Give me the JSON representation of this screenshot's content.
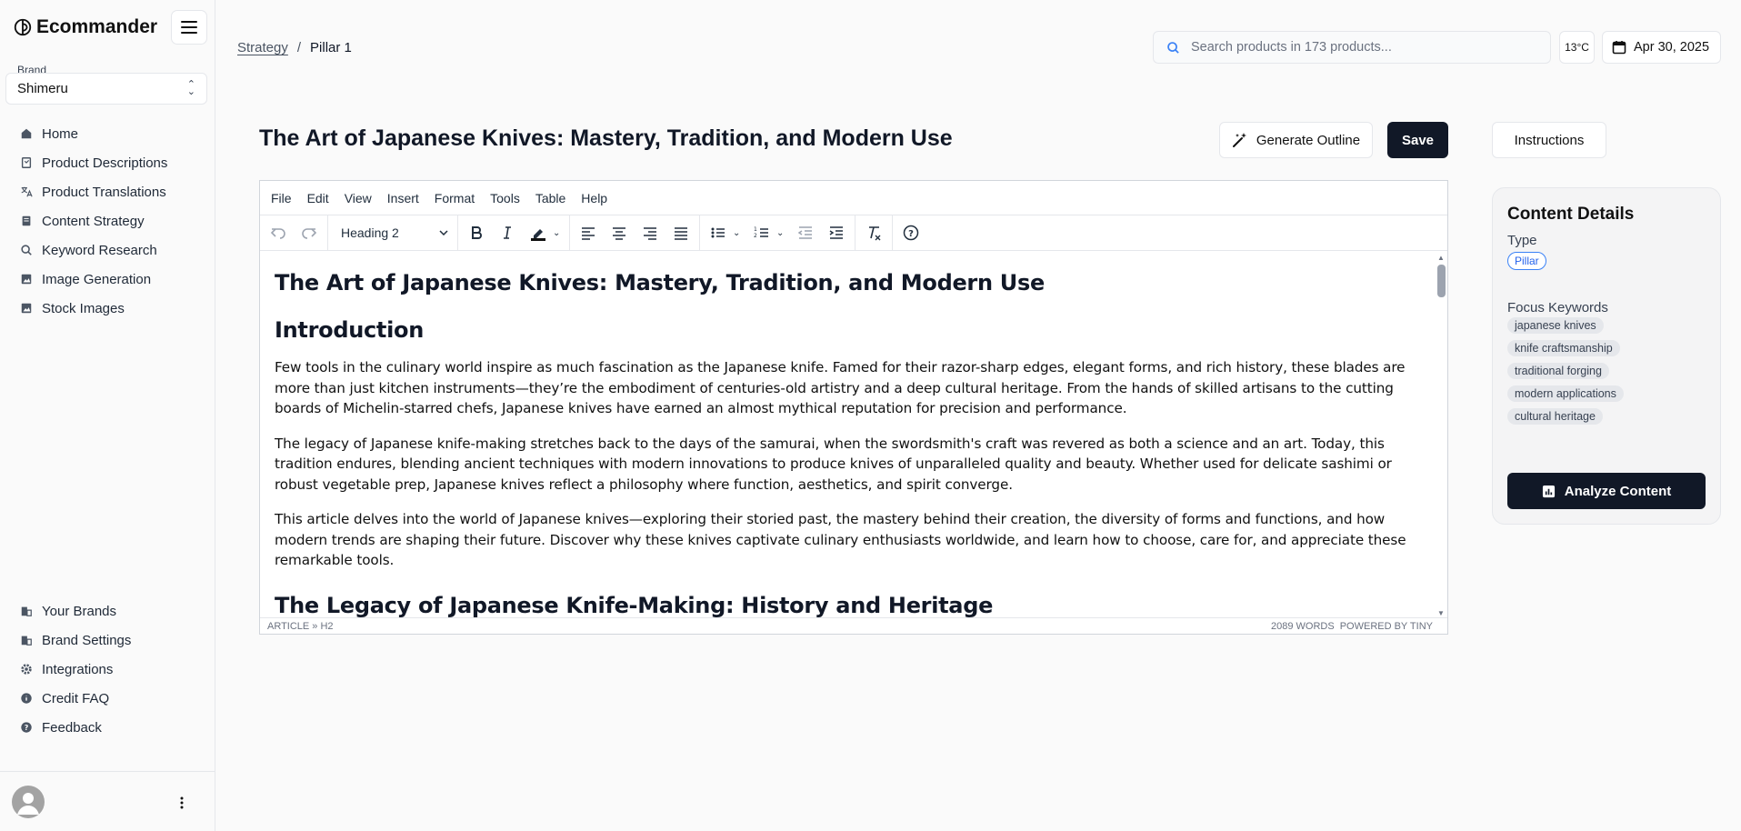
{
  "app": {
    "name": "Ecommander"
  },
  "brand": {
    "label": "Brand",
    "value": "Shimeru"
  },
  "nav_top": [
    {
      "label": "Home",
      "icon": "home-icon"
    },
    {
      "label": "Product Descriptions",
      "icon": "clipboard-icon"
    },
    {
      "label": "Product Translations",
      "icon": "translate-icon"
    },
    {
      "label": "Content Strategy",
      "icon": "book-icon"
    },
    {
      "label": "Keyword Research",
      "icon": "search-icon"
    },
    {
      "label": "Image Generation",
      "icon": "image-icon"
    },
    {
      "label": "Stock Images",
      "icon": "image-icon"
    }
  ],
  "nav_bottom": [
    {
      "label": "Your Brands",
      "icon": "building-icon"
    },
    {
      "label": "Brand Settings",
      "icon": "building-icon"
    },
    {
      "label": "Integrations",
      "icon": "gear-icon"
    },
    {
      "label": "Credit FAQ",
      "icon": "info-icon"
    },
    {
      "label": "Feedback",
      "icon": "help-icon"
    }
  ],
  "breadcrumb": {
    "parent": "Strategy",
    "separator": "/",
    "current": "Pillar 1"
  },
  "search": {
    "placeholder": "Search products in 173 products..."
  },
  "weather": {
    "temp": "13°C"
  },
  "date": {
    "value": "Apr 30, 2025"
  },
  "document": {
    "title": "The Art of Japanese Knives: Mastery, Tradition, and Modern Use"
  },
  "actions": {
    "generate_outline": "Generate Outline",
    "save": "Save",
    "instructions": "Instructions"
  },
  "editor": {
    "menus": [
      "File",
      "Edit",
      "View",
      "Insert",
      "Format",
      "Tools",
      "Table",
      "Help"
    ],
    "block_format": "Heading 2",
    "content": {
      "h1": "The Art of Japanese Knives: Mastery, Tradition, and Modern Use",
      "h2_intro": "Introduction",
      "p1": "Few tools in the culinary world inspire as much fascination as the Japanese knife. Famed for their razor-sharp edges, elegant forms, and rich history, these blades are more than just kitchen instruments—they’re the embodiment of centuries-old artistry and a deep cultural heritage. From the hands of skilled artisans to the cutting boards of Michelin-starred chefs, Japanese knives have earned an almost mythical reputation for precision and performance.",
      "p2": "The legacy of Japanese knife-making stretches back to the days of the samurai, when the swordsmith's craft was revered as both a science and an art. Today, this tradition endures, blending ancient techniques with modern innovations to produce knives of unparalleled quality and beauty. Whether used for delicate sashimi or robust vegetable prep, Japanese knives reflect a philosophy where function, aesthetics, and spirit converge.",
      "p3": "This article delves into the world of Japanese knives—exploring their storied past, the mastery behind their creation, the diversity of forms and functions, and how modern trends are shaping their future. Discover why these knives captivate culinary enthusiasts worldwide, and learn how to choose, care for, and appreciate these remarkable tools.",
      "h2_legacy": "The Legacy of Japanese Knife-Making: History and Heritage"
    },
    "status_path": "ARTICLE » H2",
    "word_count": "2089 WORDS",
    "powered_by": "POWERED BY TINY"
  },
  "details": {
    "title": "Content Details",
    "type_label": "Type",
    "type_value": "Pillar",
    "keywords_label": "Focus Keywords",
    "keywords": [
      "japanese knives",
      "knife craftsmanship",
      "traditional forging",
      "modern applications",
      "cultural heritage"
    ],
    "analyze": "Analyze Content"
  },
  "colors": {
    "primary": "#111827",
    "accent": "#2563eb",
    "background": "#fafafa"
  }
}
